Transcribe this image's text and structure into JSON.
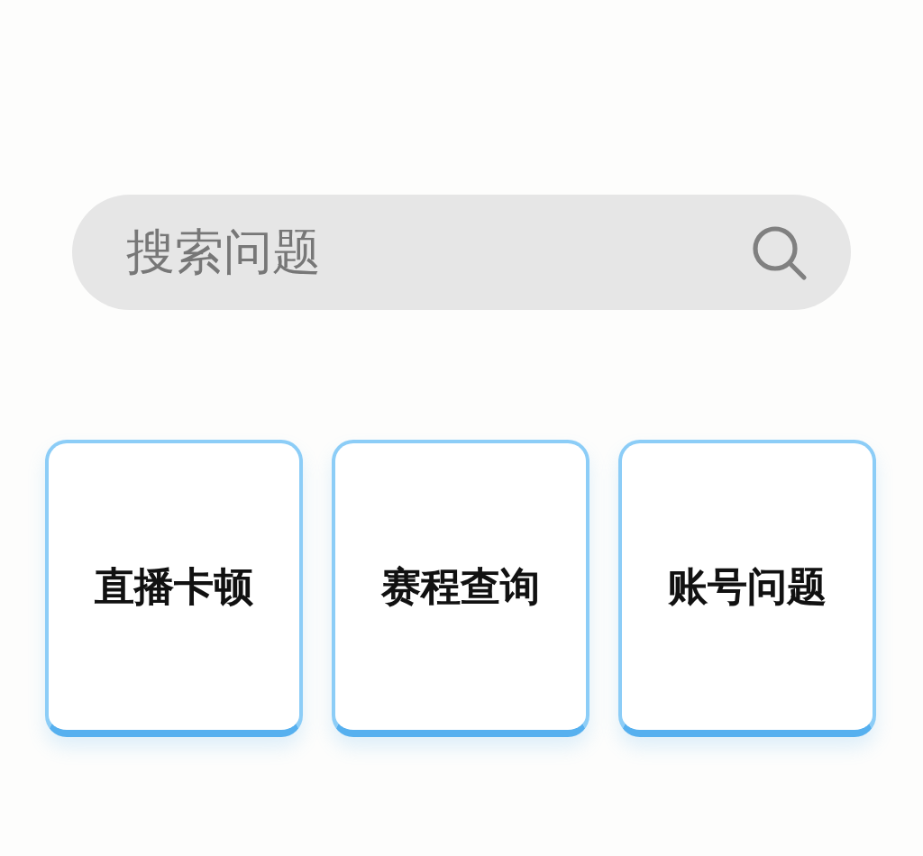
{
  "search": {
    "placeholder": "搜索问题"
  },
  "categories": [
    {
      "label": "直播卡顿"
    },
    {
      "label": "赛程查询"
    },
    {
      "label": "账号问题"
    }
  ]
}
